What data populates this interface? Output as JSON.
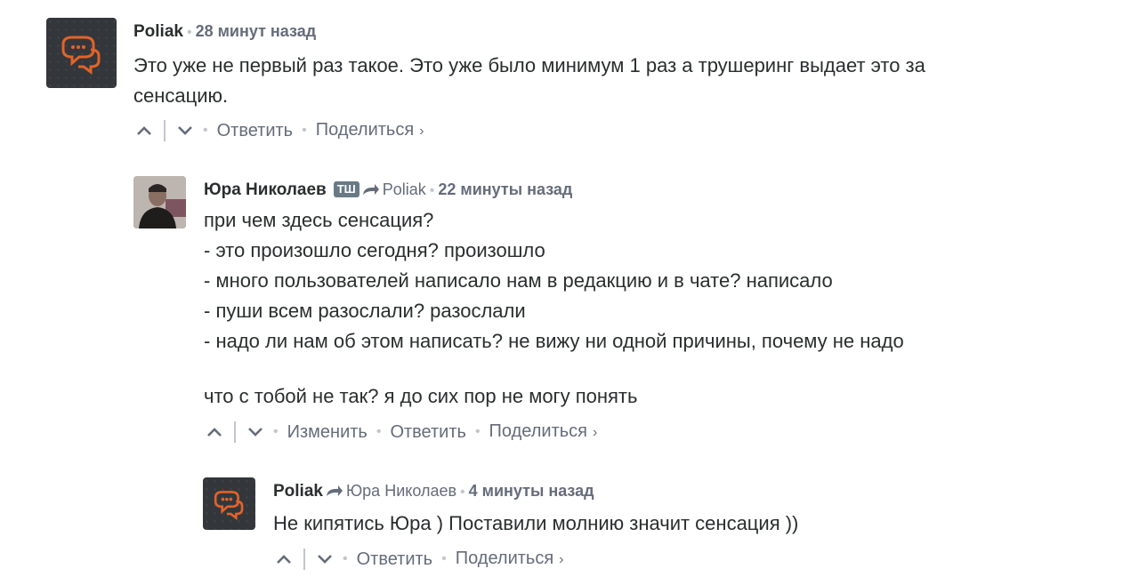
{
  "comments": [
    {
      "author": "Poliak",
      "time": "28 минут назад",
      "lines": [
        "Это уже не первый раз такое. Это уже было минимум 1 раз а трушеринг выдает это за",
        "сенсацию."
      ],
      "actions": {
        "reply": "Ответить",
        "share": "Поделиться"
      }
    },
    {
      "author": "Юра Николаев",
      "badge": "ТШ",
      "reply_to": "Poliak",
      "time": "22 минуты назад",
      "lines": [
        "при чем здесь сенсация?",
        "- это произошло сегодня? произошло",
        "- много пользователей написало нам в редакцию и в чате? написало",
        "- пуши всем разослали? разослали",
        "- надо ли нам об этом написать? не вижу ни одной причины, почему не надо"
      ],
      "extra_line": "что с тобой не так? я до сих пор не могу понять",
      "actions": {
        "edit": "Изменить",
        "reply": "Ответить",
        "share": "Поделиться"
      }
    },
    {
      "author": "Poliak",
      "reply_to": "Юра Николаев",
      "time": "4 минуты назад",
      "lines": [
        "Не кипятись Юра ) Поставили молнию значит сенсация ))"
      ],
      "actions": {
        "reply": "Ответить",
        "share": "Поделиться"
      }
    }
  ],
  "icons": {
    "upvote": "chevron-up-icon",
    "downvote": "chevron-down-icon",
    "reply_arrow": "reply-arrow-icon",
    "share_chevron": "chevron-right-icon",
    "avatar_logo": "chat-bubbles-icon"
  },
  "colors": {
    "text": "#2a2e2e",
    "meta": "#656c7a",
    "separator": "#c2c6cc",
    "logo_bg": "#33373b",
    "logo_accent": "#e2632a",
    "badge_bg": "#687a86"
  }
}
